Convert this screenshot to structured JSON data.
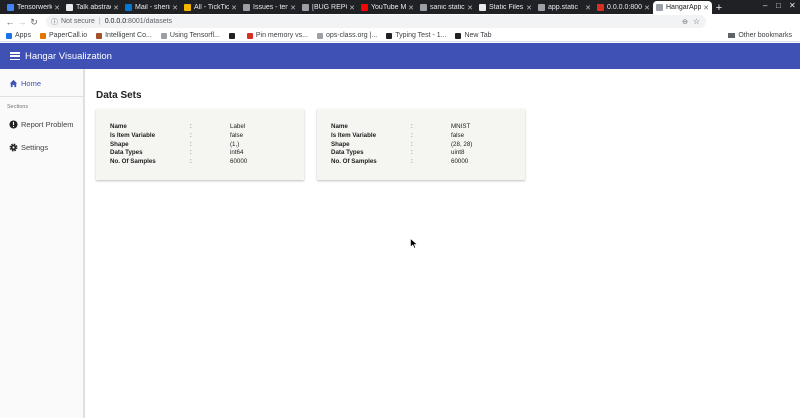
{
  "browser": {
    "tabs": [
      {
        "label": "Tensorwerk",
        "color": "#4285f4"
      },
      {
        "label": "Talk abstract",
        "color": "#e8eaed"
      },
      {
        "label": "Mail - sherin",
        "color": "#0078d4"
      },
      {
        "label": "All - TickTick",
        "color": "#f4b400"
      },
      {
        "label": "Issues - tens",
        "color": "#9aa0a6"
      },
      {
        "label": "[BUG REPORT",
        "color": "#9aa0a6"
      },
      {
        "label": "YouTube Mu",
        "color": "#ff0000"
      },
      {
        "label": "sanic static",
        "color": "#9aa0a6"
      },
      {
        "label": "Static Files",
        "color": "#e8eaed"
      },
      {
        "label": "app.static",
        "color": "#9aa0a6"
      },
      {
        "label": "0.0.0.0:800",
        "color": "#d93025"
      },
      {
        "label": "HangarApp",
        "color": "#9aa0a6",
        "active": true
      }
    ],
    "new_tab_label": "+",
    "security_label": "Not secure",
    "url_host": "0.0.0.0",
    "url_path": ":8001/datasets",
    "bookmarks": [
      {
        "label": "Apps",
        "color": "#1a73e8"
      },
      {
        "label": "PaperCall.io",
        "color": "#e37400"
      },
      {
        "label": "Intelligent Co...",
        "color": "#a0522d"
      },
      {
        "label": "Using Tensorfl...",
        "color": "#9aa0a6"
      },
      {
        "label": "",
        "color": "#202124"
      },
      {
        "label": "Pin memory vs...",
        "color": "#d93025"
      },
      {
        "label": "ops-class.org |...",
        "color": "#9aa0a6"
      },
      {
        "label": "Typing Test - 1...",
        "color": "#202124"
      },
      {
        "label": "New Tab",
        "color": "#202124"
      }
    ],
    "other_bookmarks": "Other bookmarks"
  },
  "app": {
    "title": "Hangar Visualization"
  },
  "sidebar": {
    "home_label": "Home",
    "section_label": "Sections",
    "items": [
      {
        "label": "Report Problem",
        "icon": "alert-circle-icon"
      },
      {
        "label": "Settings",
        "icon": "gear-icon"
      }
    ]
  },
  "main": {
    "title": "Data Sets",
    "cards": [
      {
        "rows": [
          {
            "key": "Name",
            "sep": ":",
            "value": "Label"
          },
          {
            "key": "Is Item Variable",
            "sep": ":",
            "value": "false"
          },
          {
            "key": "Shape",
            "sep": ":",
            "value": "(1,)"
          },
          {
            "key": "Data Types",
            "sep": ":",
            "value": "int64"
          },
          {
            "key": "No. Of Samples",
            "sep": ":",
            "value": "60000"
          }
        ]
      },
      {
        "rows": [
          {
            "key": "Name",
            "sep": ":",
            "value": "MNIST"
          },
          {
            "key": "Is Item Variable",
            "sep": ":",
            "value": "false"
          },
          {
            "key": "Shape",
            "sep": ":",
            "value": "(28, 28)"
          },
          {
            "key": "Data Types",
            "sep": ":",
            "value": "uint8"
          },
          {
            "key": "No. Of Samples",
            "sep": ":",
            "value": "60000"
          }
        ]
      }
    ]
  },
  "colors": {
    "appbar": "#3f51b5",
    "sidebar_active": "#3f51b5",
    "card_bg": "#f5f5f2"
  }
}
